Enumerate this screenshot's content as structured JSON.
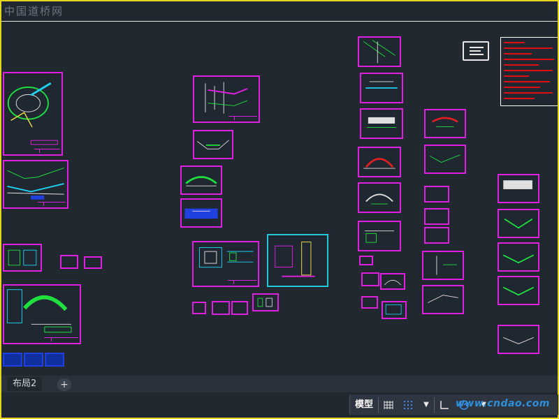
{
  "app": {
    "logo_text": "中国道桥网"
  },
  "tabs": {
    "layout_tab": "布局2",
    "add_tab": "+"
  },
  "status": {
    "model_label": "模型",
    "grid_icon": "grid-icon",
    "snap_icon": "snap-grid-icon",
    "dropdown_icon": "chevron-down-icon",
    "ortho_icon": "ortho-icon",
    "polar_icon": "polar-tracking-icon"
  },
  "watermark": {
    "text": "www.cndao.com"
  },
  "colors": {
    "sheet_border": "#e020e0",
    "cyan_border": "#20c8d8",
    "background": "#212830",
    "frame": "#e6d51a"
  }
}
